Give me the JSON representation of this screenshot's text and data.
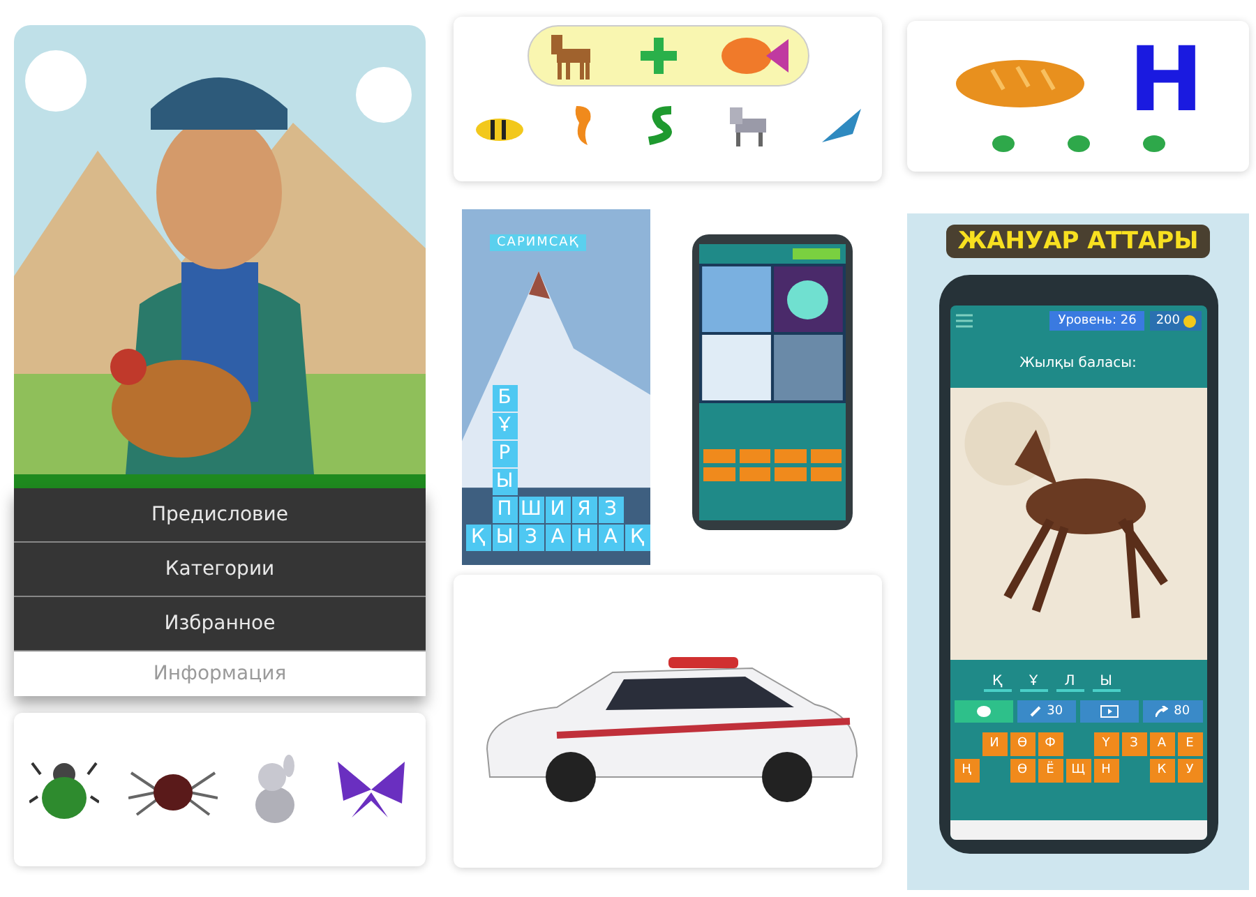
{
  "menu": {
    "items": [
      {
        "label": "Предисловие",
        "faded": false
      },
      {
        "label": "Категории",
        "faded": false
      },
      {
        "label": "Избранное",
        "faded": false
      },
      {
        "label": "Информация",
        "faded": true
      }
    ]
  },
  "letter_card": {
    "letter": "Н"
  },
  "word_game": {
    "clue": "САРИМСАҚ",
    "rows": [
      [
        "",
        "Б"
      ],
      [
        "",
        "Ұ"
      ],
      [
        "",
        "Р"
      ],
      [
        "",
        "Ы"
      ],
      [
        "",
        "П",
        "Ш",
        "И",
        "Я",
        "З"
      ],
      [
        "Қ",
        "Ы",
        "З",
        "А",
        "Н",
        "А",
        "Қ"
      ]
    ]
  },
  "animal_quiz": {
    "title": "ЖАНУАР АТТАРЫ",
    "level_badge": "Уровень: 26",
    "coins": "200",
    "question": "Жылқы баласы:",
    "answer_letters": [
      "Қ",
      "Ұ",
      "Л",
      "Ы"
    ],
    "hints": [
      {
        "kind": "chat"
      },
      {
        "kind": "brush",
        "label": "30"
      },
      {
        "kind": "video"
      },
      {
        "kind": "skip",
        "label": "80"
      }
    ],
    "keyboard": [
      [
        {
          "kind": "gap"
        },
        {
          "kind": "key",
          "label": "И"
        },
        {
          "kind": "key",
          "label": "Ө"
        },
        {
          "kind": "key",
          "label": "Ф"
        },
        {
          "kind": "gap"
        },
        {
          "kind": "key",
          "label": "Ү"
        },
        {
          "kind": "key",
          "label": "З"
        },
        {
          "kind": "key",
          "label": "А"
        },
        {
          "kind": "key",
          "label": "Е"
        }
      ],
      [
        {
          "kind": "key",
          "label": "Ң"
        },
        {
          "kind": "gap"
        },
        {
          "kind": "key",
          "label": "Ө"
        },
        {
          "kind": "key",
          "label": "Ё"
        },
        {
          "kind": "key",
          "label": "Щ"
        },
        {
          "kind": "key",
          "label": "Н"
        },
        {
          "kind": "gap"
        },
        {
          "kind": "key",
          "label": "К"
        },
        {
          "kind": "key",
          "label": "У"
        }
      ]
    ]
  }
}
